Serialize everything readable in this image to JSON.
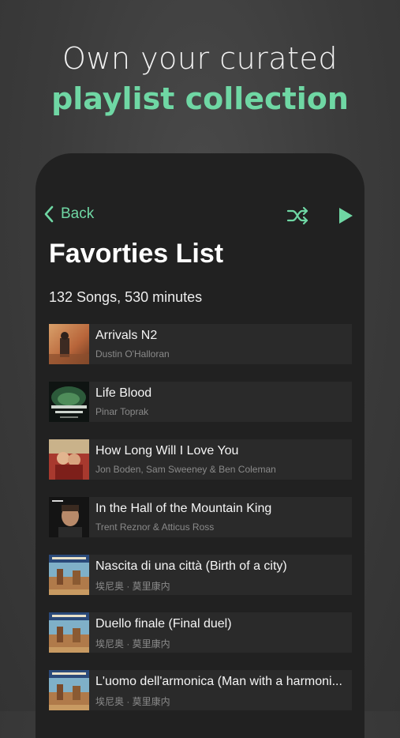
{
  "headline": {
    "line1": "Own your curated",
    "line2": "playlist collection"
  },
  "nav": {
    "back_label": "Back",
    "shuffle_icon": "shuffle-icon",
    "play_icon": "play-icon"
  },
  "playlist": {
    "title": "Favorties List",
    "summary": "132 Songs, 530 minutes"
  },
  "songs": [
    {
      "title": "Arrivals N2",
      "artist": "Dustin O'Halloran",
      "art": "arrivals-cover"
    },
    {
      "title": "Life Blood",
      "artist": "Pinar Toprak",
      "art": "our-living-world-cover"
    },
    {
      "title": "How Long Will I Love You",
      "artist": "Jon Boden, Sam Sweeney & Ben Coleman",
      "art": "about-time-cover"
    },
    {
      "title": "In the Hall of the Mountain King",
      "artist": "Trent Reznor & Atticus Ross",
      "art": "social-network-cover"
    },
    {
      "title": "Nascita di una città (Birth of a city)",
      "artist": "埃尼奥 · 莫里康内",
      "art": "western-cover"
    },
    {
      "title": "Duello finale (Final duel)",
      "artist": "埃尼奥 · 莫里康内",
      "art": "western-cover"
    },
    {
      "title": "L'uomo dell'armonica (Man with a harmoni...",
      "artist": "埃尼奥 · 莫里康内",
      "art": "western-cover"
    }
  ],
  "colors": {
    "accent": "#6fd7a4",
    "background": "#3b3b3b",
    "panel": "#212121",
    "row": "#2a2a2a"
  }
}
